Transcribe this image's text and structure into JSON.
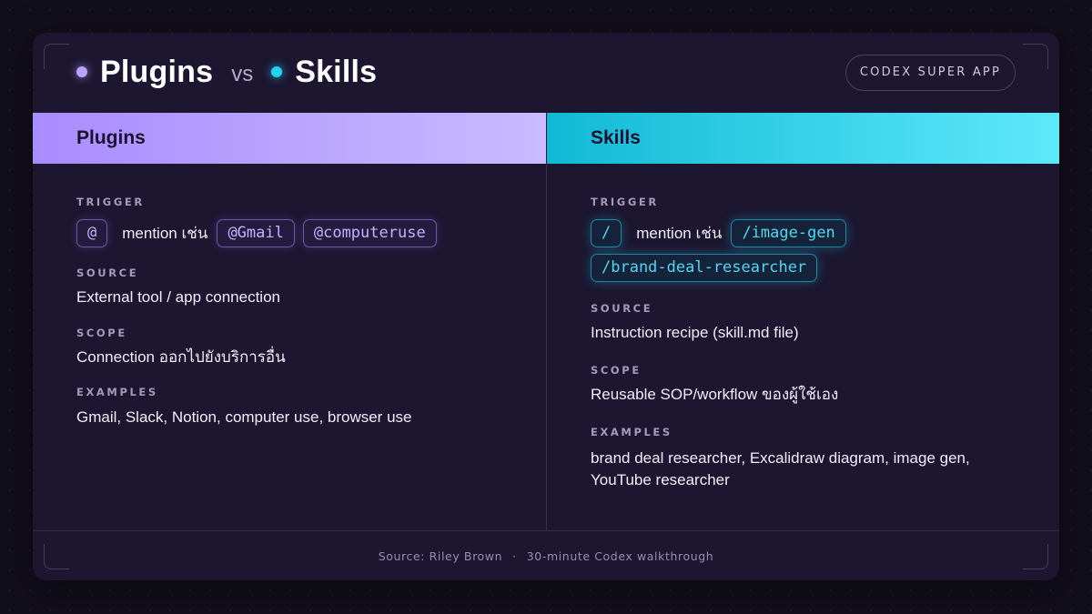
{
  "header": {
    "title_left": "Plugins",
    "vs": "vs",
    "title_right": "Skills",
    "badge": "CODEX SUPER APP"
  },
  "plugins": {
    "heading": "Plugins",
    "trigger_label": "TRIGGER",
    "trigger_symbol": "@",
    "trigger_text": "mention เช่น",
    "trigger_examples": [
      "@Gmail",
      "@computeruse"
    ],
    "source_label": "SOURCE",
    "source": "External tool / app connection",
    "scope_label": "SCOPE",
    "scope": "Connection ออกไปยังบริการอื่น",
    "examples_label": "EXAMPLES",
    "examples": "Gmail, Slack, Notion, computer use, browser use"
  },
  "skills": {
    "heading": "Skills",
    "trigger_label": "TRIGGER",
    "trigger_symbol": "/",
    "trigger_text": "mention เช่น",
    "trigger_examples": [
      "/image-gen",
      "/brand-deal-researcher"
    ],
    "source_label": "SOURCE",
    "source": "Instruction recipe (skill.md file)",
    "scope_label": "SCOPE",
    "scope": "Reusable SOP/workflow ของผู้ใช้เอง",
    "examples_label": "EXAMPLES",
    "examples": "brand deal researcher, Excalidraw diagram, image gen, YouTube researcher"
  },
  "footer": {
    "source": "Source: Riley Brown",
    "separator": "·",
    "detail": "30-minute Codex walkthrough"
  },
  "colors": {
    "background": "#120f1c",
    "card": "#1c1630",
    "plugins_accent": "#a98cff",
    "skills_accent": "#22d3ee"
  }
}
